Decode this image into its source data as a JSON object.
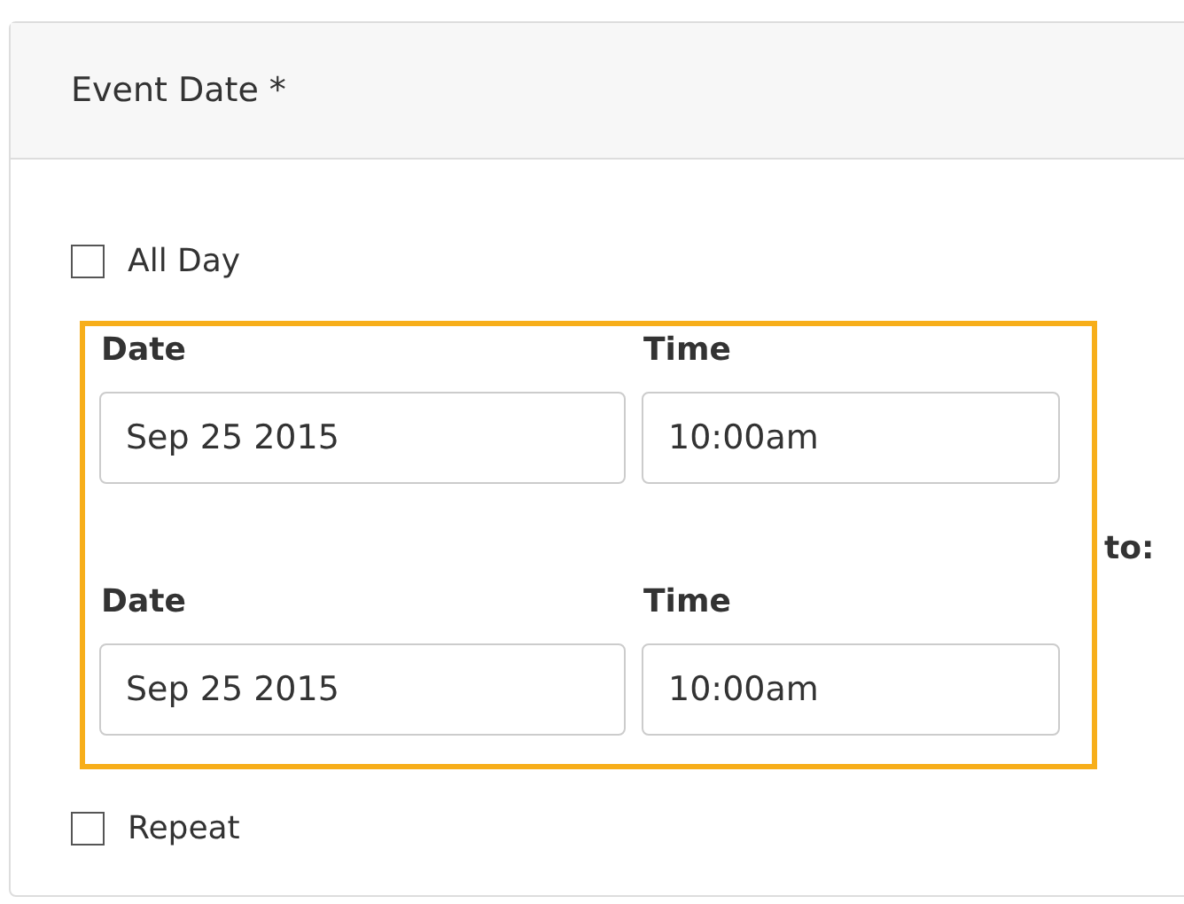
{
  "header": {
    "title": "Event Date *"
  },
  "all_day": {
    "label": "All Day",
    "checked": false
  },
  "range": {
    "highlighted": true,
    "separator": "to:",
    "rows": [
      {
        "date_label": "Date",
        "date": "Sep 25 2015",
        "time_label": "Time",
        "time": "10:00am"
      },
      {
        "date_label": "Date",
        "date": "Sep 25 2015",
        "time_label": "Time",
        "time": "10:00am"
      }
    ]
  },
  "repeat": {
    "label": "Repeat",
    "checked": false
  }
}
